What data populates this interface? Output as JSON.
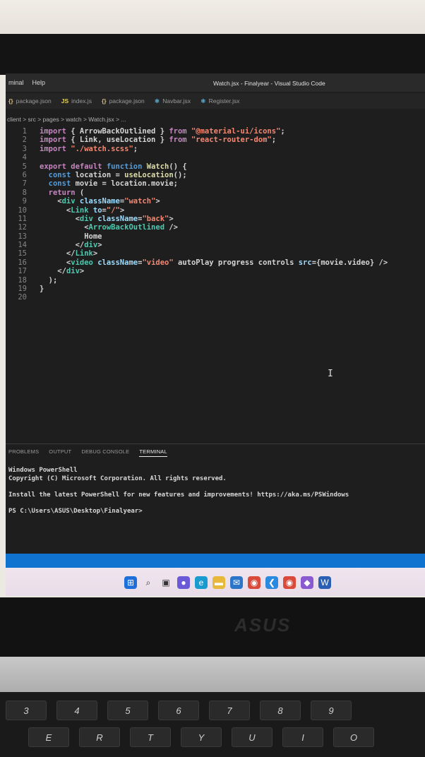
{
  "window": {
    "menu": [
      "minal",
      "Help"
    ],
    "title": "Watch.jsx - Finalyear - Visual Studio Code"
  },
  "tabs": [
    {
      "icon": "{}",
      "icon_kind": "json",
      "label": "package.json"
    },
    {
      "icon": "JS",
      "icon_kind": "js",
      "label": "index.js"
    },
    {
      "icon": "{}",
      "icon_kind": "json",
      "label": "package.json"
    },
    {
      "icon": "⚛",
      "icon_kind": "react",
      "label": "Navbar.jsx"
    },
    {
      "icon": "⚛",
      "icon_kind": "react",
      "label": "Register.jsx"
    }
  ],
  "breadcrumb": "client > src > pages > watch > Watch.jsx > ...",
  "code_lines": [
    {
      "n": "1",
      "text": "import { ArrowBackOutlined } from \"@material-ui/icons\";"
    },
    {
      "n": "2",
      "text": "import { Link, useLocation } from \"react-router-dom\";"
    },
    {
      "n": "3",
      "text": "import \"./watch.scss\";"
    },
    {
      "n": "4",
      "text": ""
    },
    {
      "n": "5",
      "text": "export default function Watch() {"
    },
    {
      "n": "6",
      "text": "  const location = useLocation();"
    },
    {
      "n": "7",
      "text": "  const movie = location.movie;"
    },
    {
      "n": "8",
      "text": "  return ("
    },
    {
      "n": "9",
      "text": "    <div className=\"watch\">"
    },
    {
      "n": "10",
      "text": "      <Link to=\"/\">"
    },
    {
      "n": "11",
      "text": "        <div className=\"back\">"
    },
    {
      "n": "12",
      "text": "          <ArrowBackOutlined />"
    },
    {
      "n": "13",
      "text": "          Home"
    },
    {
      "n": "14",
      "text": "        </div>"
    },
    {
      "n": "15",
      "text": "      </Link>"
    },
    {
      "n": "16",
      "text": "      <video className=\"video\" autoPlay progress controls src={movie.video} />"
    },
    {
      "n": "17",
      "text": "    </div>"
    },
    {
      "n": "18",
      "text": "  );"
    },
    {
      "n": "19",
      "text": "}"
    },
    {
      "n": "20",
      "text": ""
    }
  ],
  "panel": {
    "tabs": [
      "PROBLEMS",
      "OUTPUT",
      "DEBUG CONSOLE",
      "TERMINAL"
    ],
    "active_tab": "TERMINAL",
    "terminal_lines": [
      "Windows PowerShell",
      "Copyright (C) Microsoft Corporation. All rights reserved.",
      "",
      "Install the latest PowerShell for new features and improvements! https://aka.ms/PSWindows",
      "",
      "PS C:\\Users\\ASUS\\Desktop\\Finalyear>"
    ]
  },
  "taskbar_icons": [
    "windows-start",
    "search",
    "task-view",
    "chat",
    "edge",
    "file-explorer",
    "mail",
    "chrome",
    "vscode",
    "chrome-2",
    "visual-studio",
    "word"
  ],
  "laptop": {
    "brand": "ASUS"
  },
  "keys_row1": [
    "3",
    "4",
    "5",
    "6",
    "7",
    "8",
    "9"
  ],
  "keys_row2": [
    "E",
    "R",
    "T",
    "Y",
    "U",
    "I",
    "O"
  ],
  "colors": {
    "vscode_bg": "#1e1e1e",
    "status_blue": "#1073cf",
    "taskbar": "#ece0ea"
  }
}
